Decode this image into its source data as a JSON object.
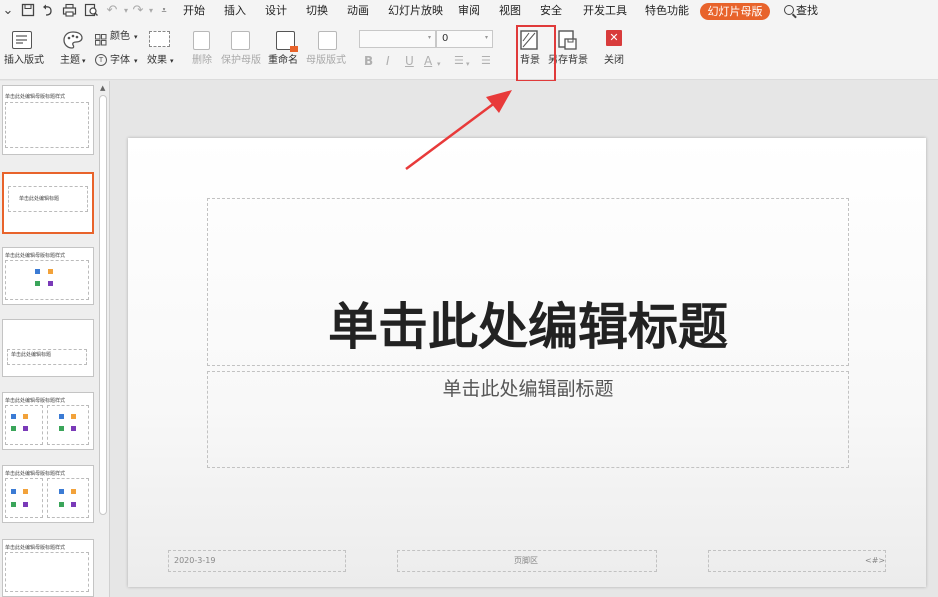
{
  "quick_access_icons": [
    "chevron-icon",
    "save-icon",
    "undo-icon",
    "print-icon",
    "print-preview-icon",
    "redo-icon",
    "customize-icon"
  ],
  "menu": {
    "items": [
      "开始",
      "插入",
      "设计",
      "切换",
      "动画",
      "幻灯片放映",
      "审阅",
      "视图",
      "安全",
      "开发工具",
      "特色功能"
    ],
    "active": "幻灯片母版",
    "search": "查找"
  },
  "ribbon": {
    "insert_layout": "插入版式",
    "theme": "主题",
    "colors": "颜色",
    "fonts": "字体",
    "effects": "效果",
    "delete": "删除",
    "protect_master": "保护母版",
    "rename": "重命名",
    "master_layout": "母版版式",
    "font_size": "0",
    "background": "背景",
    "save_background": "另存背景",
    "close": "关闭",
    "format_glyphs": [
      "B",
      "I",
      "U",
      "A"
    ]
  },
  "thumbnails": [
    {
      "title": "单击此处编辑母版标题样式"
    },
    {
      "title": "单击此处编辑标题"
    },
    {
      "title": "单击此处编辑母版标题样式"
    },
    {
      "title": "单击此处编辑标题"
    },
    {
      "title": "单击此处编辑母版标题样式"
    },
    {
      "title": "单击此处编辑母版标题样式"
    },
    {
      "title": "单击此处编辑母版标题样式"
    }
  ],
  "slide": {
    "title": "单击此处编辑标题",
    "subtitle": "单击此处编辑副标题",
    "footer_date": "2020-3-19",
    "footer_center": "页脚区",
    "footer_number": "<#>"
  },
  "colors": {
    "accent": "#e8632b",
    "highlight": "#e03a3a",
    "close": "#d83b3b"
  }
}
